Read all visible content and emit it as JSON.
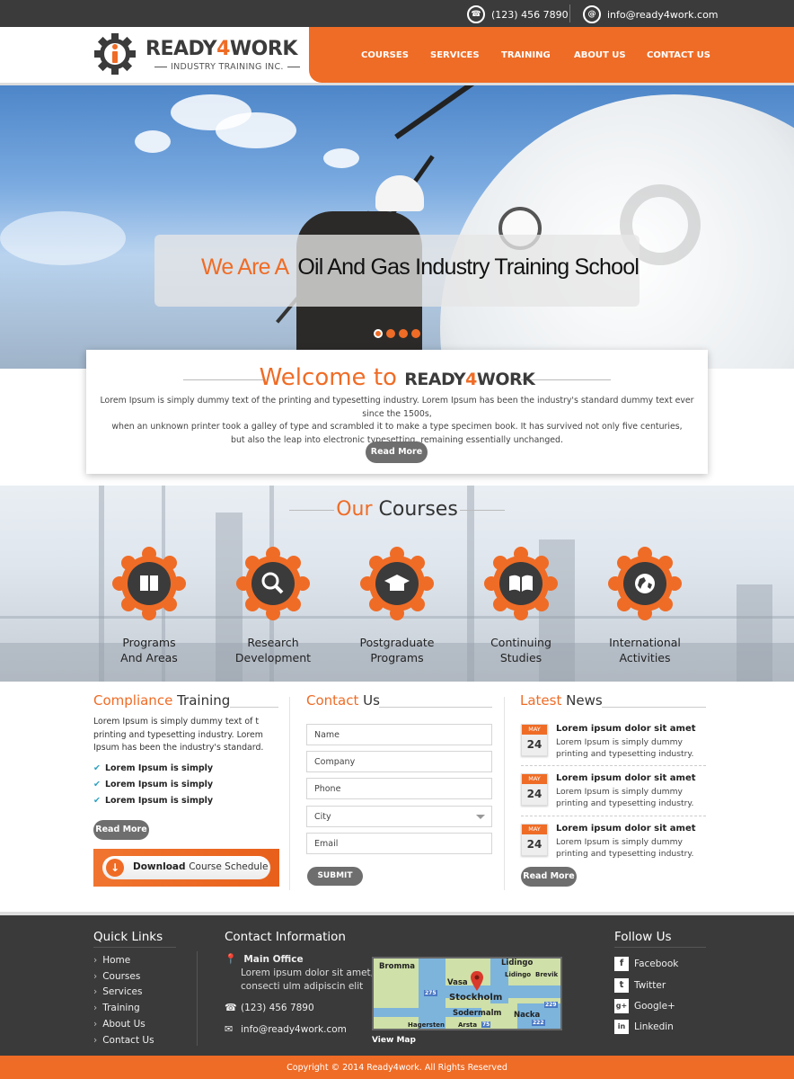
{
  "topbar": {
    "phone": "(123) 456 7890",
    "email": "info@ready4work.com"
  },
  "logo": {
    "brand_a": "READY",
    "brand_b": "4",
    "brand_c": "WORK",
    "tagline": "INDUSTRY TRAINING INC."
  },
  "nav": [
    "COURSES",
    "SERVICES",
    "TRAINING",
    "ABOUT US",
    "CONTACT US"
  ],
  "hero": {
    "accent": "We Are A",
    "caption": "Oil And Gas Industry Training School",
    "slides": 4,
    "active_slide": 1
  },
  "welcome": {
    "title": "Welcome to",
    "brand_a": "READY",
    "brand_b": "4",
    "brand_c": "WORK",
    "text1": "Lorem Ipsum is simply dummy text of the printing and typesetting industry. Lorem Ipsum has been the industry's standard dummy text ever since the 1500s,",
    "text2": "when an unknown printer took a galley of type and scrambled it to make a type specimen book. It has survived not only five centuries,",
    "text3": "but also the leap into electronic typesetting, remaining essentially unchanged.",
    "button": "Read More"
  },
  "courses": {
    "title_accent": "Our",
    "title": "Courses",
    "items": [
      {
        "line1": "Programs",
        "line2": "And Areas",
        "icon": "book-icon"
      },
      {
        "line1": "Research",
        "line2": "Development",
        "icon": "magnifier-icon"
      },
      {
        "line1": "Postgraduate",
        "line2": "Programs",
        "icon": "graduation-cap-icon"
      },
      {
        "line1": "Continuing",
        "line2": "Studies",
        "icon": "open-book-icon"
      },
      {
        "line1": "International",
        "line2": "Activities",
        "icon": "globe-icon"
      }
    ]
  },
  "compliance": {
    "title_accent": "Compliance",
    "title": "Training",
    "text": "Lorem Ipsum is simply dummy text of t printing and typesetting industry. Lorem Ipsum has been the industry's standard.",
    "checks": [
      "Lorem Ipsum is simply",
      "Lorem Ipsum is simply",
      "Lorem Ipsum is simply"
    ],
    "button": "Read More",
    "download_bold": "Download",
    "download_rest": "Course Schedule"
  },
  "contact": {
    "title_accent": "Contact",
    "title": "Us",
    "fields": [
      "Name",
      "Company",
      "Phone",
      "City",
      "Email"
    ],
    "button": "SUBMIT"
  },
  "news": {
    "title_accent": "Latest",
    "title": "News",
    "items": [
      {
        "month": "MAY",
        "day": "24",
        "title": "Lorem ipsum dolor sit amet",
        "text": "Lorem Ipsum is simply dummy printing and typesetting industry."
      },
      {
        "month": "MAY",
        "day": "24",
        "title": "Lorem ipsum dolor sit amet",
        "text": "Lorem Ipsum is simply dummy printing and typesetting industry."
      },
      {
        "month": "MAY",
        "day": "24",
        "title": "Lorem ipsum dolor sit amet",
        "text": "Lorem Ipsum is simply dummy printing and typesetting industry."
      }
    ],
    "button": "Read More"
  },
  "footer": {
    "quick_title": "Quick Links",
    "quick_links": [
      "Home",
      "Courses",
      "Services",
      "Training",
      "About Us",
      "Contact Us"
    ],
    "contact_title": "Contact Information",
    "office_label": "Main Office",
    "address1": "Lorem ipsum dolor sit amet,",
    "address2": "consecti ulm adipiscin elit",
    "phone": "(123) 456 7890",
    "email": "info@ready4work.com",
    "map_link": "View Map",
    "map_labels": [
      "Bromma",
      "Lidingo",
      "Vasa",
      "Lidingo",
      "Brevik",
      "Stockholm",
      "Sodermalm",
      "Nacka",
      "Hagersten",
      "Arsta",
      "275",
      "222",
      "75",
      "229"
    ],
    "follow_title": "Follow Us",
    "social": [
      {
        "label": "Facebook",
        "icon": "facebook-icon",
        "glyph": "f"
      },
      {
        "label": "Twitter",
        "icon": "twitter-icon",
        "glyph": "t"
      },
      {
        "label": "Google+",
        "icon": "google-plus-icon",
        "glyph": "g+"
      },
      {
        "label": "Linkedin",
        "icon": "linkedin-icon",
        "glyph": "in"
      }
    ],
    "copyright": "Copyright © 2014 Ready4work. All Rights Reserved"
  },
  "colors": {
    "accent": "#ef6c26",
    "dark": "#3a3a3a",
    "button_gray": "#6e6e6e",
    "check": "#2b9fc0"
  }
}
